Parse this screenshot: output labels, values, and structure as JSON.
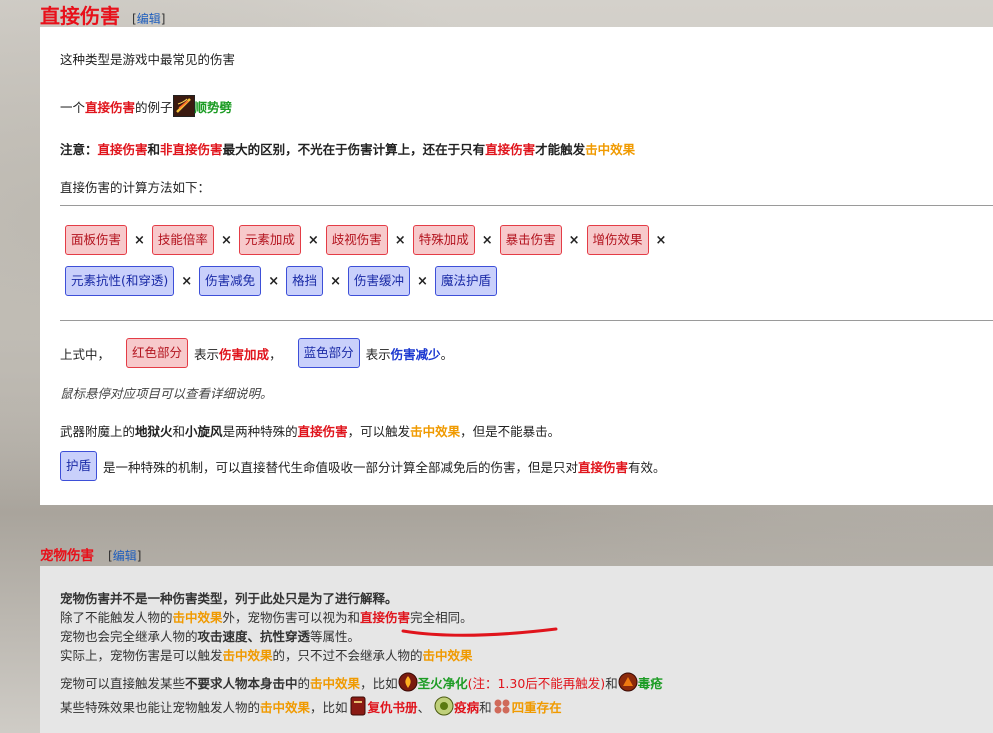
{
  "section1": {
    "title": "直接伤害",
    "edit_label": "编辑",
    "intro": "这种类型是游戏中最常见的伤害",
    "example": {
      "prefix": "一个",
      "term": "直接伤害",
      "middle": "的例子",
      "skill": "顺势劈"
    },
    "note": {
      "label": "注意：",
      "t1": "直接伤害",
      "t2": "和",
      "t3": "非直接伤害",
      "t4": "最大的区别，不光在于伤害计算上，还在于只有",
      "t5": "直接伤害",
      "t6": "才能触发",
      "t7": "击中效果"
    },
    "calc_intro": "直接伤害的计算方法如下：",
    "red_terms": [
      "面板伤害",
      "技能倍率",
      "元素加成",
      "歧视伤害",
      "特殊加成",
      "暴击伤害",
      "增伤效果"
    ],
    "blue_terms": [
      "元素抗性(和穿透)",
      "伤害减免",
      "格挡",
      "伤害缓冲",
      "魔法护盾"
    ],
    "multiply": "×",
    "legend": {
      "prefix": "上式中，",
      "red_chip": "红色部分",
      "red_text": "表示",
      "red_term": "伤害加成",
      "sep": "，",
      "blue_chip": "蓝色部分",
      "blue_text": "表示",
      "blue_term": "伤害减少",
      "end": "。"
    },
    "hover_hint": "鼠标悬停对应项目可以查看详细说明。",
    "weapon": {
      "t1": "武器附魔上的",
      "t2": "地狱火",
      "t3": "和",
      "t4": "小旋风",
      "t5": "是两种特殊的",
      "t6": "直接伤害",
      "t7": "，可以触发",
      "t8": "击中效果",
      "t9": "，但是不能暴击。"
    },
    "shield": {
      "chip": "护盾",
      "t1": "是一种特殊的机制，可以直接替代生命值吸收一部分计算全部减免后的伤害，但是只对",
      "t2": "直接伤害",
      "t3": "有效。"
    }
  },
  "section2": {
    "title": "宠物伤害",
    "edit_label": "编辑",
    "line1": "宠物伤害并不是一种伤害类型，列于此处只是为了进行解释。",
    "line2": {
      "t1": "除了不能触发人物的",
      "t2": "击中效果",
      "t3": "外，宠物伤害可以视为和",
      "t4": "直接伤害",
      "t5": "完全相同。"
    },
    "line3": {
      "t1": "宠物也会完全继承人物的",
      "t2": "攻击速度、抗性穿透",
      "t3": "等属性。"
    },
    "line4": {
      "t1": "实际上，宠物伤害是可以触发",
      "t2": "击中效果",
      "t3": "的，只不过不会继承人物的",
      "t4": "击中效果"
    },
    "line5": {
      "t1": "宠物可以直接触发某些",
      "t2": "不要求人物本身击中",
      "t3": "的",
      "t4": "击中效果",
      "t5": "，比如",
      "t6": "圣火净化",
      "t7": "(注：1.30后不能再触发)",
      "t8": "和",
      "t9": "毒疮"
    },
    "line6": {
      "t1": "某些特殊效果也能让宠物触发人物的",
      "t2": "击中效果",
      "t3": "，比如",
      "t4": "复仇书册",
      "t5": "、",
      "t6": "疫病",
      "t7": "和",
      "t8": "四重存在"
    }
  },
  "colors": {
    "red": "#e0141c",
    "orange": "#f09a00",
    "green": "#1c9c24",
    "blue": "#1a37d0"
  },
  "icons": [
    "sword-slash-icon",
    "holy-fire-icon",
    "poison-sore-icon",
    "revenge-book-icon",
    "plague-icon",
    "quadruple-existence-icon"
  ]
}
